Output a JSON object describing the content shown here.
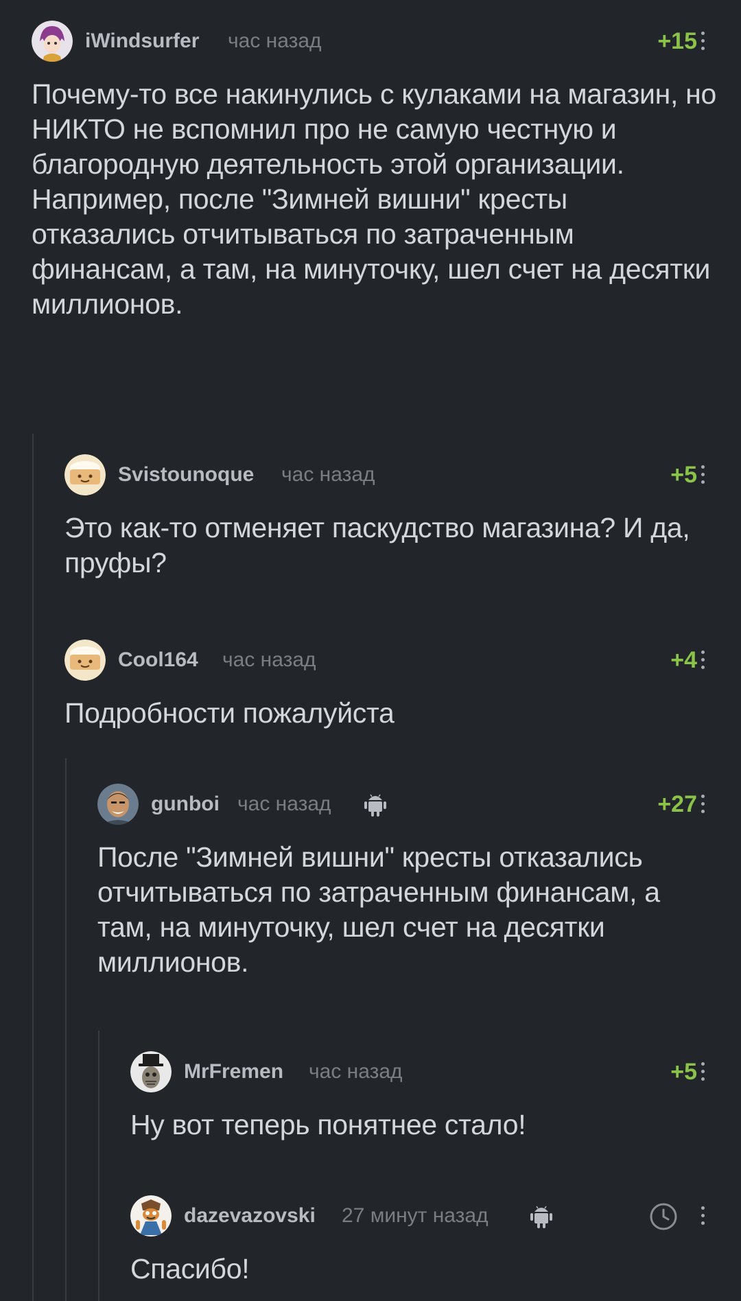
{
  "comments": [
    {
      "author": "iWindsurfer",
      "time": "час назад",
      "rating": "+15",
      "avatar": "anime-avatar",
      "paragraphs": [
        "Почему-то все накинулись с кулаками на магазин, но НИКТО не вспомнил про не самую честную и благородную деятельность этой организации.",
        "Например, после \"Зимней вишни\" кресты отказались отчитываться по затраченным финансам, а там, на минуточку, шел счет на десятки миллионов."
      ]
    },
    {
      "author": "Svistounoque",
      "time": "час назад",
      "rating": "+5",
      "avatar": "default-cake-avatar",
      "paragraphs": [
        "Это как-то отменяет паскудство магазина? И да, пруфы?"
      ]
    },
    {
      "author": "Cool164",
      "time": "час назад",
      "rating": "+4",
      "avatar": "default-cake-avatar",
      "paragraphs": [
        "Подробности пожалуйста"
      ]
    },
    {
      "author": "gunboi",
      "time": "час назад",
      "rating": "+27",
      "avatar": "photo-avatar",
      "device_icon": "android-icon",
      "paragraphs": [
        "После \"Зимней вишни\" кресты отказались отчитываться по затраченным финансам, а там, на минуточку, шел счет на десятки миллионов."
      ]
    },
    {
      "author": "MrFremen",
      "time": "час назад",
      "rating": "+5",
      "avatar": "tophat-avatar",
      "paragraphs": [
        "Ну вот теперь понятнее стало!"
      ]
    },
    {
      "author": "dazevazovski",
      "time": "27 минут назад",
      "rating": "",
      "avatar": "crash-avatar",
      "device_icon": "android-icon",
      "rating_icon": "clock-icon",
      "paragraphs": [
        "Спасибо!"
      ]
    }
  ],
  "colors": {
    "background": "#222529",
    "rating": "#8bc34a",
    "text": "#d4d7da",
    "author": "#b8bcc2",
    "time": "#7a7e84",
    "thread_line": "#3a3e44"
  }
}
